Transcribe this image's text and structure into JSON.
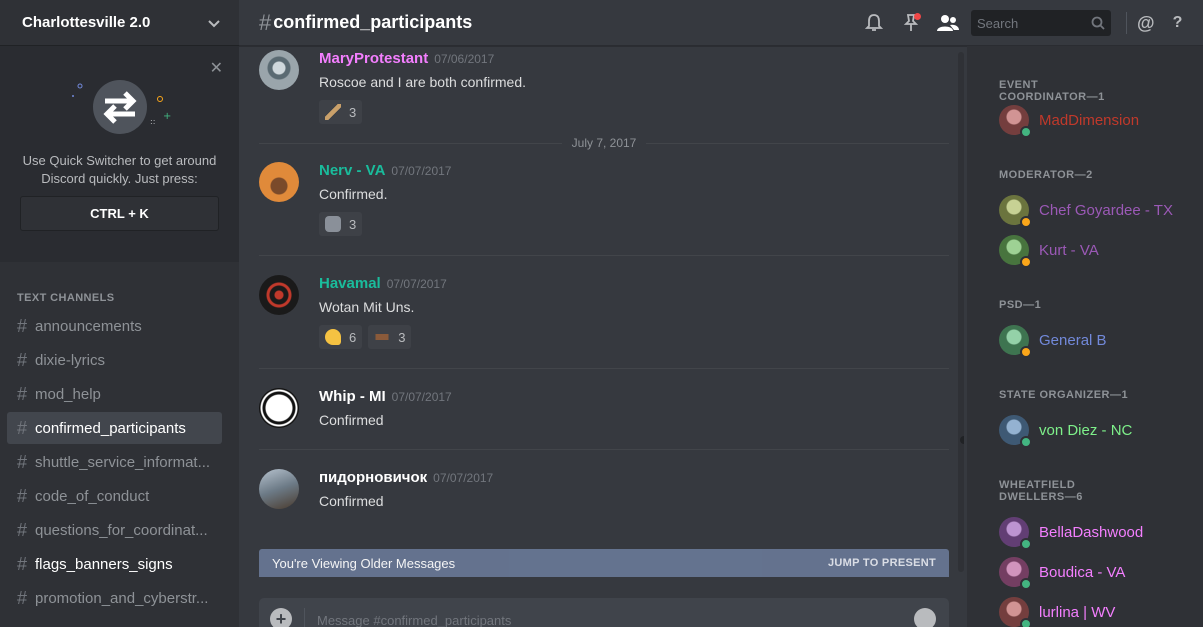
{
  "server": {
    "name": "Charlottesville 2.0"
  },
  "quick_switcher": {
    "text": "Use Quick Switcher to get around Discord quickly. Just press:",
    "shortcut": "CTRL + K"
  },
  "channels": {
    "heading": "TEXT CHANNELS",
    "items": [
      {
        "label": "announcements",
        "state": "normal"
      },
      {
        "label": "dixie-lyrics",
        "state": "normal"
      },
      {
        "label": "mod_help",
        "state": "normal"
      },
      {
        "label": "confirmed_participants",
        "state": "active"
      },
      {
        "label": "shuttle_service_informat...",
        "state": "normal"
      },
      {
        "label": "code_of_conduct",
        "state": "normal"
      },
      {
        "label": "questions_for_coordinat...",
        "state": "normal"
      },
      {
        "label": "flags_banners_signs",
        "state": "unread"
      },
      {
        "label": "promotion_and_cyberstr...",
        "state": "normal"
      }
    ]
  },
  "header": {
    "hash": "#",
    "channel": "confirmed_participants",
    "search_placeholder": "Search",
    "icons": [
      "bell-icon",
      "pin-icon",
      "members-icon",
      "search-icon",
      "at-icon",
      "help-icon"
    ]
  },
  "messages": [
    {
      "author": "MaryProtestant",
      "color": "#f47fff",
      "timestamp": "07/06/2017",
      "content": "Roscoe and I are both confirmed.",
      "reactions": [
        {
          "emoji": "knife",
          "count": "3"
        }
      ]
    },
    {
      "author": "Nerv - VA",
      "color": "#1abc9c",
      "timestamp": "07/07/2017",
      "content": "Confirmed.",
      "reactions": [
        {
          "emoji": "wolf",
          "count": "3"
        }
      ]
    },
    {
      "author": "Havamal",
      "color": "#1abc9c",
      "timestamp": "07/07/2017",
      "content": "Wotan Mit Uns.",
      "reactions": [
        {
          "emoji": "flexed-biceps",
          "count": "6"
        },
        {
          "emoji": "horse",
          "count": "3"
        }
      ]
    },
    {
      "author": "Whip - MI",
      "color": "#ffffff",
      "timestamp": "07/07/2017",
      "content": "Confirmed",
      "reactions": []
    },
    {
      "author": "пидорновичок",
      "color": "#ffffff",
      "timestamp": "07/07/2017",
      "content": "Confirmed",
      "reactions": []
    }
  ],
  "date_divider": "July 7, 2017",
  "older_bar": {
    "text": "You're Viewing Older Messages",
    "jump": "JUMP TO PRESENT"
  },
  "composer": {
    "placeholder": "Message #confirmed_participants"
  },
  "members": {
    "roles": [
      {
        "title": "EVENT COORDINATOR—1",
        "members": [
          {
            "name": "MadDimension",
            "color": "#c0392b",
            "status": "online"
          }
        ]
      },
      {
        "title": "MODERATOR—2",
        "members": [
          {
            "name": "Chef Goyardee - TX",
            "color": "#9b59b6",
            "status": "idle"
          },
          {
            "name": "Kurt - VA",
            "color": "#9b59b6",
            "status": "idle"
          }
        ]
      },
      {
        "title": "PSD—1",
        "members": [
          {
            "name": "General B",
            "color": "#7289da",
            "status": "idle"
          }
        ]
      },
      {
        "title": "STATE ORGANIZER—1",
        "members": [
          {
            "name": "von Diez - NC",
            "color": "#7ef08a",
            "status": "online"
          }
        ]
      },
      {
        "title": "WHEATFIELD DWELLERS—6",
        "members": [
          {
            "name": "BellaDashwood",
            "color": "#f47fff",
            "status": "online"
          },
          {
            "name": "Boudica - VA",
            "color": "#f47fff",
            "status": "online"
          },
          {
            "name": "lurlina | WV",
            "color": "#f47fff",
            "status": "online"
          }
        ]
      }
    ]
  },
  "colors": {
    "online": "#43b581",
    "idle": "#faa61a"
  }
}
